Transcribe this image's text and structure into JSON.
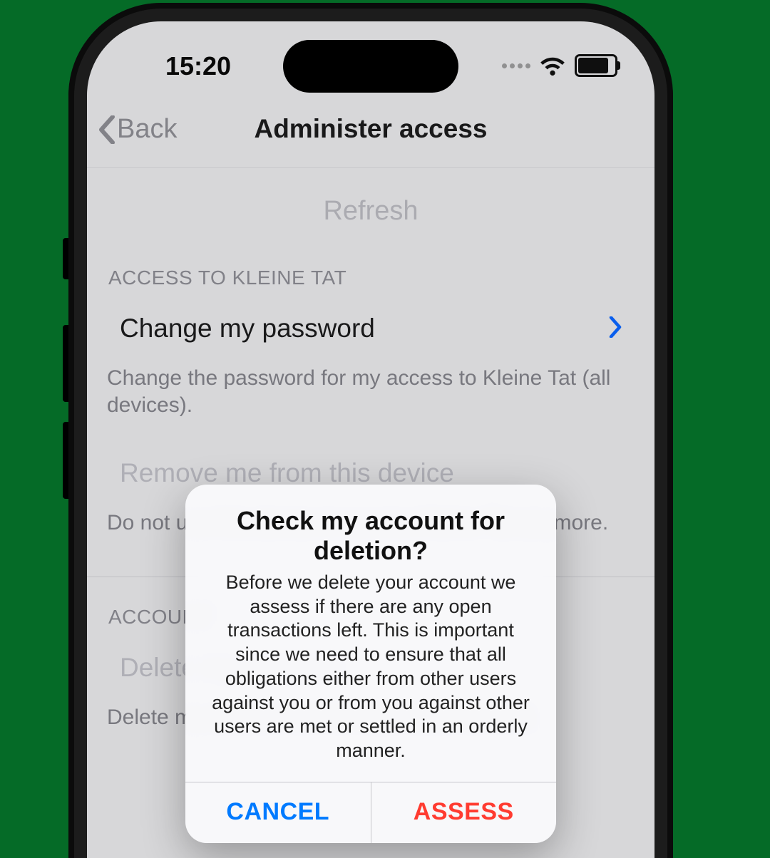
{
  "status": {
    "time": "15:20"
  },
  "nav": {
    "back_label": "Back",
    "title": "Administer access"
  },
  "refresh_label": "Refresh",
  "section1": {
    "header": "ACCESS TO KLEINE TAT",
    "row_change_pw": "Change my password",
    "desc_change_pw": "Change the password for my access to Kleine Tat (all devices).",
    "row_remove": "Remove me from this device",
    "desc_remove": "Do not use this device to access Kleine Tat anymore."
  },
  "section2": {
    "header": "ACCOUNT",
    "row_delete": "Delete my account",
    "desc_delete": "Delete my account and all data attached to it."
  },
  "alert": {
    "title": "Check my account for deletion?",
    "message": "Before we delete your account we assess if there are any open transactions left. This is important since we need to ensure that all obligations either from other users against you or from you against other users are met or settled in an orderly manner.",
    "cancel": "CANCEL",
    "confirm": "ASSESS"
  }
}
